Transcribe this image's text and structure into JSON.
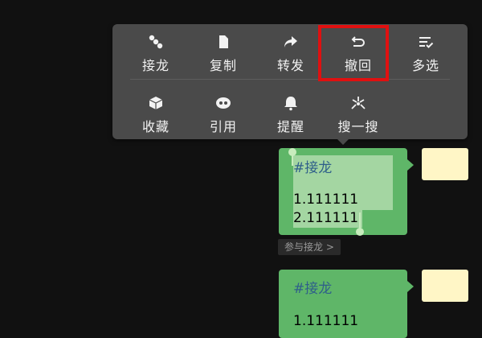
{
  "menu": {
    "row1": [
      {
        "label": "接龙",
        "icon": "chain-icon"
      },
      {
        "label": "复制",
        "icon": "copy-icon"
      },
      {
        "label": "转发",
        "icon": "forward-icon"
      },
      {
        "label": "撤回",
        "icon": "recall-icon"
      },
      {
        "label": "多选",
        "icon": "multiselect-icon"
      }
    ],
    "row2": [
      {
        "label": "收藏",
        "icon": "favorite-icon"
      },
      {
        "label": "引用",
        "icon": "quote-icon"
      },
      {
        "label": "提醒",
        "icon": "bell-icon"
      },
      {
        "label": "搜一搜",
        "icon": "search-one-icon"
      }
    ]
  },
  "messages": [
    {
      "tag": "#接龙",
      "line1": "1.111111",
      "line2": "2.111111"
    },
    {
      "tag": "#接龙",
      "line1": "1.111111"
    }
  ],
  "join_chip": "参与接龙 >",
  "colors": {
    "bubble": "#5fb668",
    "highlight": "#e01010",
    "menu_bg": "#4a4a4a",
    "avatar": "#fff6c6"
  }
}
